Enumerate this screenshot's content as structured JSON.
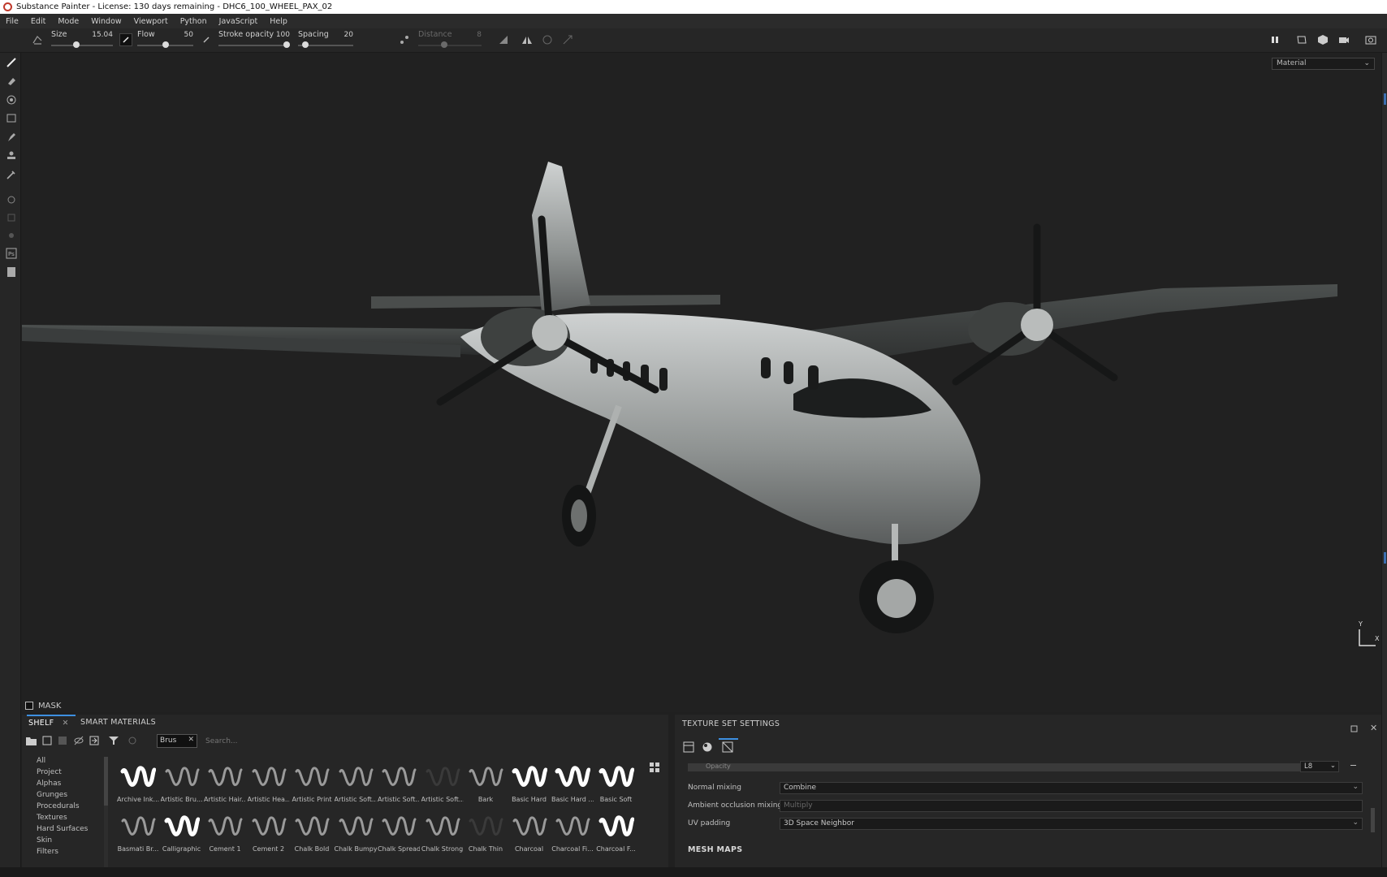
{
  "window": {
    "title": "Substance Painter - License: 130 days remaining - DHC6_100_WHEEL_PAX_02"
  },
  "menu": [
    "File",
    "Edit",
    "Mode",
    "Window",
    "Viewport",
    "Python",
    "JavaScript",
    "Help"
  ],
  "toolbar": {
    "size": {
      "label": "Size",
      "value": "15.04",
      "fraction": 0.4
    },
    "flow": {
      "label": "Flow",
      "value": "50",
      "fraction": 0.5
    },
    "stroke_opacity": {
      "label": "Stroke opacity",
      "value": "100",
      "fraction": 1.0
    },
    "spacing": {
      "label": "Spacing",
      "value": "20",
      "fraction": 0.08
    },
    "distance": {
      "label": "Distance",
      "value": "8",
      "fraction": 0.4
    }
  },
  "viewport": {
    "display_mode": "Material",
    "mask_label": "MASK"
  },
  "shelf": {
    "tabs": [
      "SHELF",
      "SMART MATERIALS"
    ],
    "filter_chip": "Brus",
    "search_placeholder": "Search...",
    "categories": [
      "All",
      "Project",
      "Alphas",
      "Grunges",
      "Procedurals",
      "Textures",
      "Hard Surfaces",
      "Skin",
      "Filters"
    ],
    "brushes_row1": [
      "Archive Ink...",
      "Artistic Bru...",
      "Artistic Hair...",
      "Artistic Hea...",
      "Artistic Print",
      "Artistic Soft...",
      "Artistic Soft...",
      "Artistic Soft...",
      "Bark",
      "Basic Hard",
      "Basic Hard ...",
      "Basic Soft"
    ],
    "brushes_row2": [
      "Basmati Br...",
      "Calligraphic",
      "Cement 1",
      "Cement 2",
      "Chalk Bold",
      "Chalk Bumpy",
      "Chalk Spread",
      "Chalk Strong",
      "Chalk Thin",
      "Charcoal",
      "Charcoal Fi...",
      "Charcoal F..."
    ]
  },
  "texture_set_settings": {
    "title": "TEXTURE SET SETTINGS",
    "opacity_label": "Opacity",
    "channel_format": "L8",
    "normal_mixing": {
      "label": "Normal mixing",
      "value": "Combine"
    },
    "ao_mixing": {
      "label": "Ambient occlusion mixing",
      "value": "Multiply"
    },
    "uv_padding": {
      "label": "UV padding",
      "value": "3D Space Neighbor"
    },
    "mesh_maps_header": "MESH MAPS"
  },
  "colors": {
    "accent": "#3d8fe0",
    "panel": "#262626",
    "viewport": "#212121"
  }
}
